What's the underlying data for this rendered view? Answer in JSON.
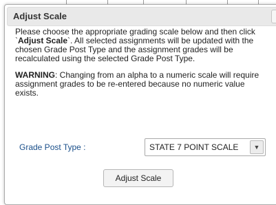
{
  "dialog": {
    "title": "Adjust Scale",
    "close_symbol": "X",
    "intro": {
      "before": "Please choose the appropriate grading scale below and then click `",
      "bold": "Adjust Scale",
      "after": "`. All selected assignments will be updated with the chosen Grade Post Type and the assignment grades will be recalculated using the selected Grade Post Type."
    },
    "warning": {
      "label": "WARNING",
      "text": ": Changing from an alpha to a numeric scale will require assignment grades to be re-entered because no numeric value exists."
    },
    "grade_post_type": {
      "label": "Grade Post Type :",
      "selected": "STATE 7 POINT SCALE"
    },
    "adjust_button": "Adjust Scale"
  },
  "colors": {
    "label_blue": "#1a4f8a",
    "titlebar": "#e9e9e9"
  }
}
